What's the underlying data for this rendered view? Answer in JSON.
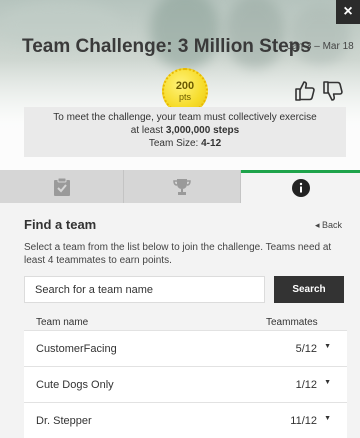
{
  "window": {
    "close_label": "×"
  },
  "header": {
    "title": "Team Challenge: 3 Million Steps",
    "dates": "Jan 3 – Mar 18",
    "points_value": "200",
    "points_label": "pts"
  },
  "info": {
    "line1": "To meet the challenge, your team must collectively exercise",
    "line2_prefix": "at least ",
    "line2_bold": "3,000,000 steps",
    "size_label": "Team Size: ",
    "size_value": "4-12"
  },
  "tabs": [
    {
      "icon": "clipboard-check-icon"
    },
    {
      "icon": "trophy-icon"
    },
    {
      "icon": "info-icon",
      "active": true
    }
  ],
  "find": {
    "title": "Find a team",
    "back_label": "Back",
    "description": "Select a team from the list below to join the challenge. Teams need at least 4 teammates to earn points.",
    "search_placeholder": "Search for a team name",
    "search_button": "Search",
    "col_name": "Team name",
    "col_teammates": "Teammates",
    "teams": [
      {
        "name": "CustomerFacing",
        "count": "5/12"
      },
      {
        "name": "Cute Dogs Only",
        "count": "1/12"
      },
      {
        "name": "Dr. Stepper",
        "count": "11/12"
      }
    ]
  },
  "colors": {
    "accent": "#1ea34a",
    "badge": "#f6dc2a",
    "button": "#333333"
  }
}
